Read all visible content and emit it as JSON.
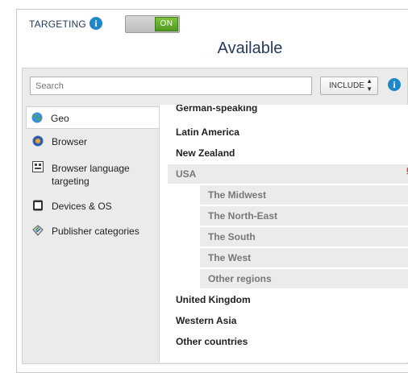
{
  "header": {
    "targeting_label": "TARGETING",
    "toggle_label": "ON",
    "toggle_state": "on",
    "available_title": "Available"
  },
  "search": {
    "placeholder": "Search",
    "mode_select": "INCLUDE"
  },
  "sidebar": {
    "items": [
      {
        "label": "Geo",
        "icon": "globe-icon",
        "active": true
      },
      {
        "label": "Browser",
        "icon": "browser-icon",
        "active": false
      },
      {
        "label": "Browser language targeting",
        "icon": "language-icon",
        "active": false
      },
      {
        "label": "Devices & OS",
        "icon": "device-icon",
        "active": false
      },
      {
        "label": "Publisher categories",
        "icon": "category-icon",
        "active": false
      }
    ]
  },
  "list": {
    "partial_top": "German-speaking",
    "rows": [
      {
        "label": "Latin America"
      },
      {
        "label": "New Zealand"
      },
      {
        "label": "USA",
        "selected": true
      }
    ],
    "sub_rows": [
      {
        "label": "The Midwest"
      },
      {
        "label": "The North-East"
      },
      {
        "label": "The South"
      },
      {
        "label": "The West"
      },
      {
        "label": "Other regions"
      }
    ],
    "rows_after": [
      {
        "label": "United Kingdom"
      },
      {
        "label": "Western Asia"
      },
      {
        "label": "Other countries"
      }
    ]
  },
  "colors": {
    "accent": "#1f86c7",
    "title": "#253a5e",
    "toggle_on": "#5fa82a"
  }
}
